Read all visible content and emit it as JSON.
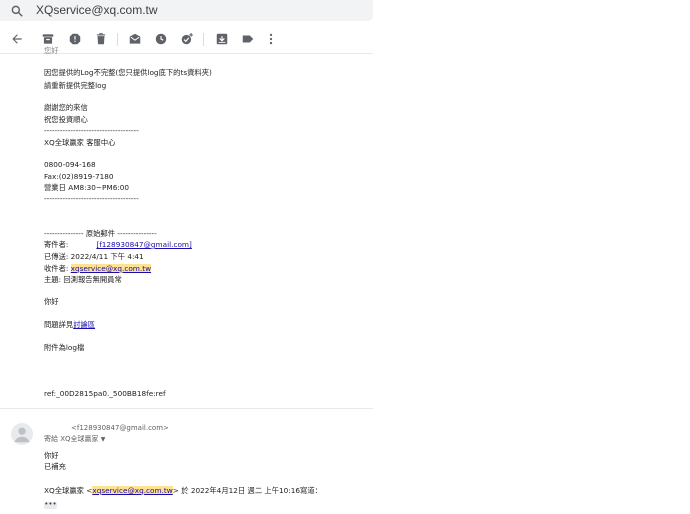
{
  "search": {
    "value": "XQservice@xq.com.tw"
  },
  "toolbar": {
    "icons": [
      "back-arrow-icon",
      "archive-icon",
      "report-spam-icon",
      "delete-icon",
      "mark-unread-icon",
      "snooze-icon",
      "add-to-tasks-icon",
      "move-to-icon",
      "label-icon",
      "more-vert-icon"
    ]
  },
  "message1": {
    "top_cut": "您好",
    "body1": "因您提供的Log不完整(您只提供log底下的ts資料夾)",
    "body2": "請重新提供完整log",
    "thanks1": "謝謝您的來信",
    "thanks2": "祝您投資順心",
    "dash1": "------------------------------------",
    "signature_name": "XQ全球贏家 客服中心",
    "phone": "0800-094-168",
    "fax": "Fax:(02)8919-7180",
    "hours": "營業日 AM8:30~PM6:00",
    "dash2": "------------------------------------",
    "orig_header": "--------------- 原始郵件 ---------------",
    "from_label": "寄件者:",
    "from_value": "[f128930847@gmail.com]",
    "sent": "已傳送: 2022/4/11 下午 4:41",
    "to_label": "收件者: ",
    "to_value": "xqservice@xq.com.tw",
    "subject": "主題: 回測報告無開員常",
    "greeting": "你好",
    "problem_prefix": "問題詳見",
    "problem_link": "討論區",
    "attach": "附件為log檔",
    "ref": "ref:_00D2815pa0._500BB18fe:ref"
  },
  "message2": {
    "sender_email": "<f128930847@gmail.com>",
    "to_line": "寄給 XQ全球贏家",
    "greeting": "你好",
    "body": "已補充",
    "quote_prefix": "XQ全球贏家 <",
    "quote_email": "xqservice@xq.com.tw",
    "quote_suffix": "> 於 2022年4月12日 週二 上午10:16寫道："
  },
  "colors": {
    "link": "#1a0dab",
    "highlight": "#fde293",
    "icon": "#5f6368"
  }
}
